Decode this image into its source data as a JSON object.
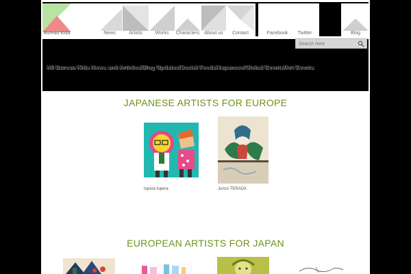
{
  "nav": {
    "logo": "Bureau Kida",
    "items": [
      "News",
      "Artists",
      "Works",
      "Characters",
      "About us",
      "Contact"
    ],
    "social": [
      "Facebook",
      "Twitter"
    ],
    "blog": "Blog"
  },
  "search": {
    "placeholder": "Search here"
  },
  "banner": {
    "text": "All Bureau Kida News and Articles/Blog Updates/Social Feeds/Japanese/Global Events/Art Events"
  },
  "sections": {
    "japanese": {
      "title": "JAPANESE ARTISTS FOR EUROPE",
      "artists": [
        "tupera tupera",
        "Junzo TERADA"
      ]
    },
    "european": {
      "title": "EUROPEAN ARTISTS FOR JAPAN"
    }
  },
  "colors": {
    "accent": "#6f8f1a",
    "logo_green": "#b9e3a4",
    "logo_red": "#f08a8a"
  }
}
